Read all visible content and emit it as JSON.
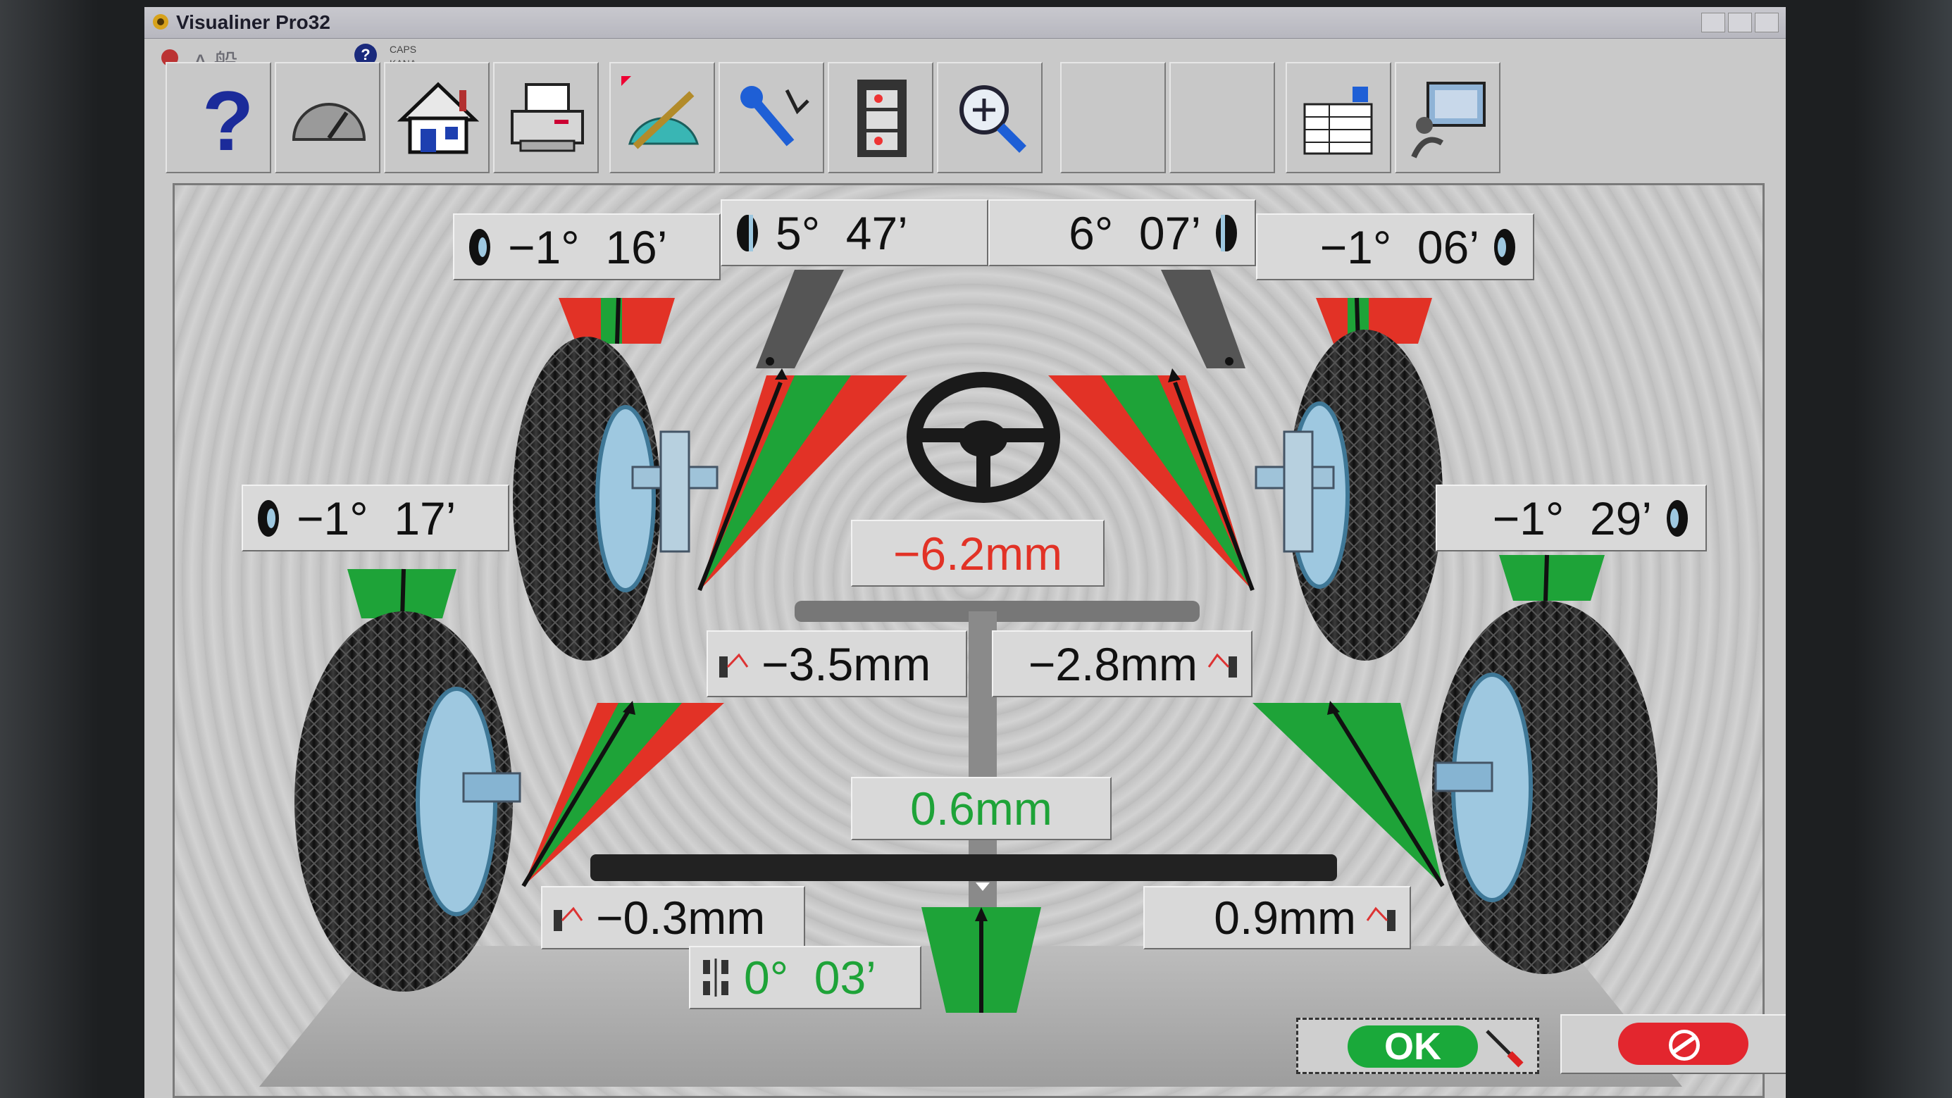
{
  "window": {
    "title": "Visualiner Pro32",
    "ime_label": "A 般",
    "caps_label": "CAPS",
    "kana_label": "KANA"
  },
  "toolbar": [
    {
      "name": "help",
      "icon": "question-mark-icon"
    },
    {
      "name": "gauge",
      "icon": "speedometer-icon"
    },
    {
      "name": "home",
      "icon": "home-icon"
    },
    {
      "name": "print",
      "icon": "printer-icon"
    },
    {
      "name": "measure",
      "icon": "protractor-icon"
    },
    {
      "name": "adjust",
      "icon": "wrench-icon"
    },
    {
      "name": "video",
      "icon": "film-icon"
    },
    {
      "name": "zoom",
      "icon": "zoom-in-icon"
    },
    {
      "name": "blank1",
      "icon": "empty"
    },
    {
      "name": "blank2",
      "icon": "empty"
    },
    {
      "name": "spec",
      "icon": "spreadsheet-icon"
    },
    {
      "name": "monitor",
      "icon": "technician-monitor-icon"
    }
  ],
  "readings": {
    "front_left_camber": "−1°  16’",
    "front_left_caster": "5°  47’",
    "front_right_caster": "6°  07’",
    "front_right_camber": "−1°  06’",
    "rear_left_camber": "−1°  17’",
    "rear_right_camber": "−1°  29’",
    "front_total_toe": "−6.2mm",
    "front_left_toe": "−3.5mm",
    "front_right_toe": "−2.8mm",
    "rear_total_toe": "0.6mm",
    "rear_left_toe": "−0.3mm",
    "rear_right_toe": "0.9mm",
    "thrust_angle": "0°  03’"
  },
  "buttons": {
    "ok_label": "OK"
  },
  "colors": {
    "in_spec": "#1ea338",
    "out_of_spec": "#e23226"
  }
}
